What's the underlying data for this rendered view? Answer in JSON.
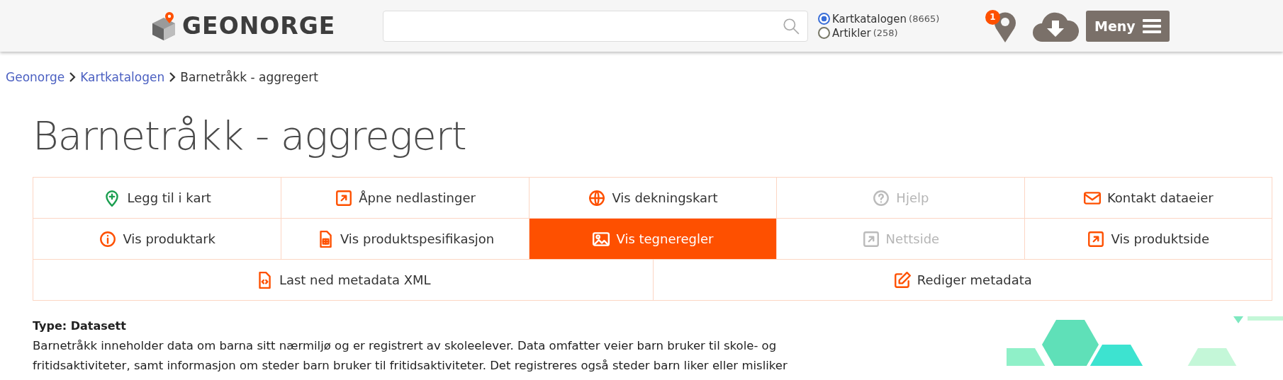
{
  "header": {
    "logo": "GEONORGE",
    "scopes": [
      {
        "label": "Kartkatalogen",
        "count": "(8665)",
        "selected": true
      },
      {
        "label": "Artikler",
        "count": "(258)",
        "selected": false
      }
    ],
    "map_badge": "1",
    "menu_button": "Meny"
  },
  "breadcrumb": [
    {
      "label": "Geonorge",
      "link": true
    },
    {
      "label": "Kartkatalogen",
      "link": true
    },
    {
      "label": "Barnetråkk - aggregert",
      "link": false
    }
  ],
  "title": "Barnetråkk - aggregert",
  "actions": [
    [
      {
        "label": "Legg til i kart",
        "selected": false,
        "disabled": false
      },
      {
        "label": "Åpne nedlastinger",
        "selected": false,
        "disabled": false
      },
      {
        "label": "Vis dekningskart",
        "selected": false,
        "disabled": false
      },
      {
        "label": "Hjelp",
        "selected": false,
        "disabled": true
      },
      {
        "label": "Kontakt dataeier",
        "selected": false,
        "disabled": false
      }
    ],
    [
      {
        "label": "Vis produktark",
        "selected": false,
        "disabled": false
      },
      {
        "label": "Vis produktspesifikasjon",
        "selected": false,
        "disabled": false
      },
      {
        "label": "Vis tegneregler",
        "selected": true,
        "disabled": false
      },
      {
        "label": "Nettside",
        "selected": false,
        "disabled": true
      },
      {
        "label": "Vis produktside",
        "selected": false,
        "disabled": false
      }
    ],
    [
      {
        "label": "Last ned metadata XML",
        "selected": false,
        "disabled": false
      },
      {
        "label": "Rediger metadata",
        "selected": false,
        "disabled": false
      }
    ]
  ],
  "description": {
    "type_label": "Type: Datasett",
    "text": "Barnetråkk inneholder data om barna sitt nærmiljø og er registrert av skoleelever. Data omfatter veier barn bruker til skole- og fritidsaktiviteter, samt informasjon om steder barn bruker til fritidsaktiviteter. Det registreres også steder barn liker eller misliker"
  }
}
